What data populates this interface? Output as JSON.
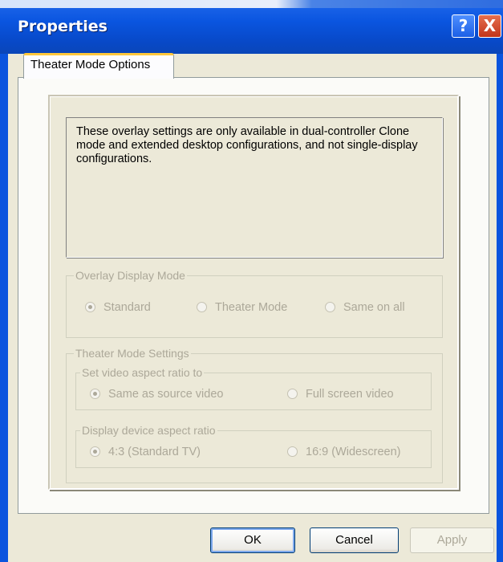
{
  "window": {
    "title": "Properties",
    "help_glyph": "?",
    "close_glyph": "X"
  },
  "tab": {
    "label": "Theater Mode Options"
  },
  "info_text": "These overlay settings are only available in dual-controller Clone mode and extended desktop configurations, and not single-display configurations.",
  "overlay_group": {
    "legend": "Overlay Display Mode",
    "options": [
      {
        "label": "Standard",
        "selected": true
      },
      {
        "label": "Theater Mode",
        "selected": false
      },
      {
        "label": "Same on all",
        "selected": false
      }
    ]
  },
  "theater_group": {
    "legend": "Theater Mode Settings",
    "aspect_group": {
      "legend": "Set video aspect ratio to",
      "options": [
        {
          "label": "Same as source video",
          "selected": true
        },
        {
          "label": "Full screen video",
          "selected": false
        }
      ]
    },
    "device_group": {
      "legend": "Display device aspect ratio",
      "options": [
        {
          "label": "4:3 (Standard TV)",
          "selected": true
        },
        {
          "label": "16:9 (Widescreen)",
          "selected": false
        }
      ]
    }
  },
  "buttons": {
    "ok": "OK",
    "cancel": "Cancel",
    "apply": "Apply"
  },
  "colors": {
    "titlebar": "#0a54de",
    "dialog_bg": "#ece9d8",
    "disabled_text": "#aca899",
    "tab_highlight": "#ffc83c"
  }
}
